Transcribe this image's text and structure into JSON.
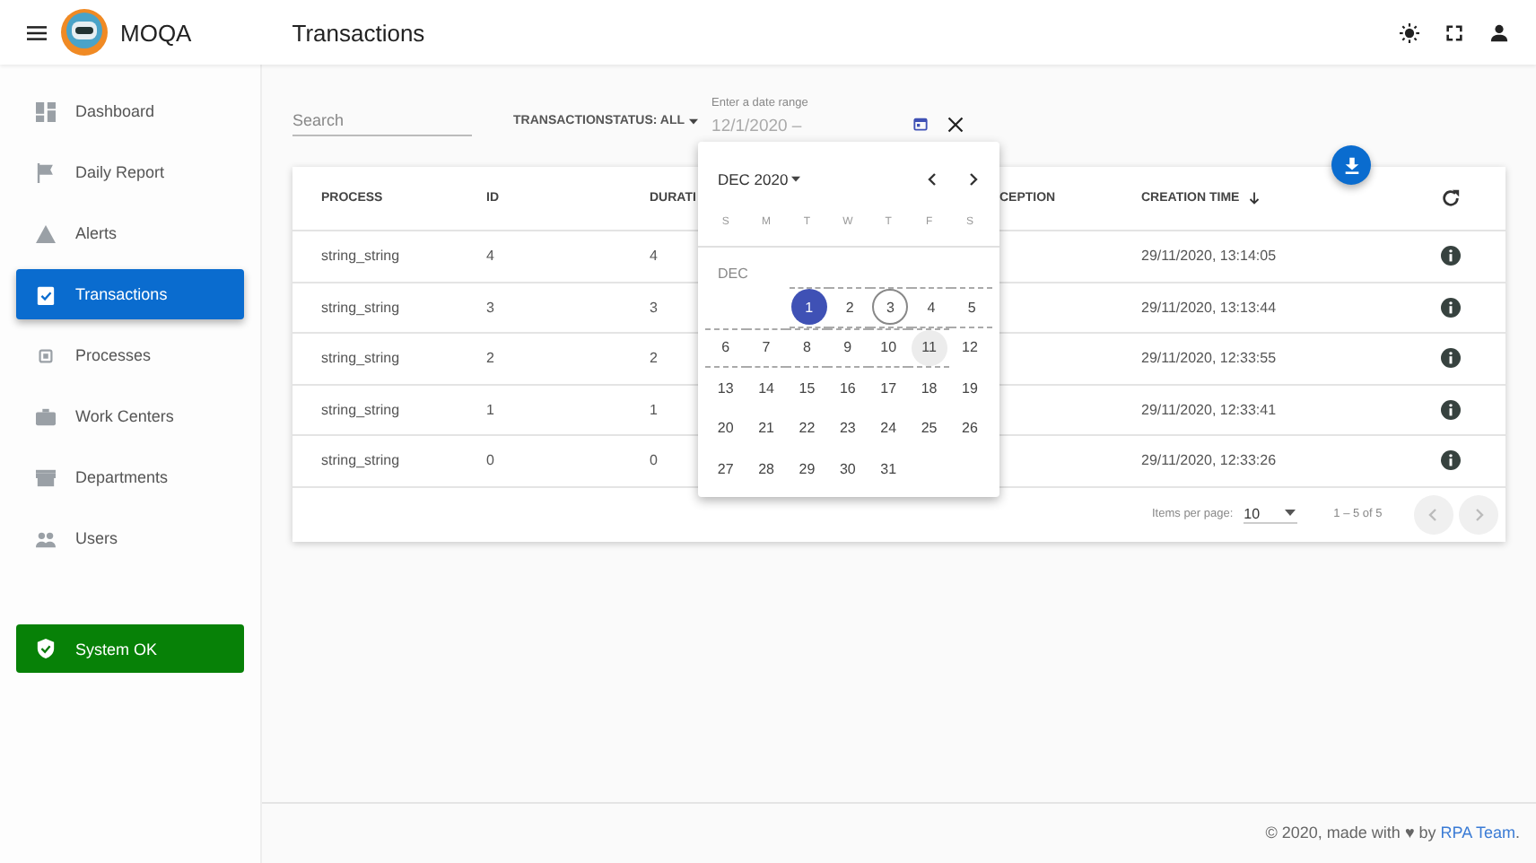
{
  "app": {
    "name": "MOQA",
    "page_title": "Transactions"
  },
  "sidebar": {
    "items": [
      {
        "label": "Dashboard",
        "selected": false
      },
      {
        "label": "Daily Report",
        "selected": false
      },
      {
        "label": "Alerts",
        "selected": false
      },
      {
        "label": "Transactions",
        "selected": true
      },
      {
        "label": "Processes",
        "selected": false
      },
      {
        "label": "Work Centers",
        "selected": false
      },
      {
        "label": "Departments",
        "selected": false
      },
      {
        "label": "Users",
        "selected": false
      }
    ],
    "status": {
      "label": "System OK",
      "ok": true
    }
  },
  "filters": {
    "search_placeholder": "Search",
    "status_filter": "TRANSACTIONSTATUS: ALL",
    "date_label": "Enter a date range",
    "date_value": "12/1/2020 –"
  },
  "table": {
    "columns": [
      "PROCESS",
      "ID",
      "DURATI",
      "CEPTION",
      "CREATION TIME"
    ],
    "rows": [
      {
        "process": "string_string",
        "id": "4",
        "duration": "4",
        "created": "29/11/2020, 13:14:05"
      },
      {
        "process": "string_string",
        "id": "3",
        "duration": "3",
        "created": "29/11/2020, 13:13:44"
      },
      {
        "process": "string_string",
        "id": "2",
        "duration": "2",
        "created": "29/11/2020, 12:33:55"
      },
      {
        "process": "string_string",
        "id": "1",
        "duration": "1",
        "created": "29/11/2020, 12:33:41"
      },
      {
        "process": "string_string",
        "id": "0",
        "duration": "0",
        "created": "29/11/2020, 12:33:26"
      }
    ],
    "paginator": {
      "items_label": "Items per page:",
      "page_size": "10",
      "range": "1 – 5 of 5"
    }
  },
  "calendar": {
    "period": "DEC 2020",
    "weekdays": [
      "S",
      "M",
      "T",
      "W",
      "T",
      "F",
      "S"
    ],
    "month_label": "DEC",
    "weeks": [
      [
        {
          "day": "1",
          "selected": true,
          "today": false,
          "preview": true,
          "hovered": false
        },
        {
          "day": "2",
          "selected": false,
          "today": false,
          "preview": true,
          "hovered": false
        },
        {
          "day": "3",
          "selected": false,
          "today": true,
          "preview": true,
          "hovered": false
        },
        {
          "day": "4",
          "selected": false,
          "today": false,
          "preview": true,
          "hovered": false
        },
        {
          "day": "5",
          "selected": false,
          "today": false,
          "preview": true,
          "hovered": false
        }
      ],
      [
        {
          "day": "6",
          "selected": false,
          "today": false,
          "preview": true,
          "hovered": false
        },
        {
          "day": "7",
          "selected": false,
          "today": false,
          "preview": true,
          "hovered": false
        },
        {
          "day": "8",
          "selected": false,
          "today": false,
          "preview": true,
          "hovered": false
        },
        {
          "day": "9",
          "selected": false,
          "today": false,
          "preview": true,
          "hovered": false
        },
        {
          "day": "10",
          "selected": false,
          "today": false,
          "preview": true,
          "hovered": false
        },
        {
          "day": "11",
          "selected": false,
          "today": false,
          "preview": true,
          "hovered": true
        },
        {
          "day": "12",
          "selected": false,
          "today": false,
          "preview": false,
          "hovered": false
        }
      ],
      [
        {
          "day": "13",
          "selected": false,
          "today": false,
          "preview": false,
          "hovered": false
        },
        {
          "day": "14",
          "selected": false,
          "today": false,
          "preview": false,
          "hovered": false
        },
        {
          "day": "15",
          "selected": false,
          "today": false,
          "preview": false,
          "hovered": false
        },
        {
          "day": "16",
          "selected": false,
          "today": false,
          "preview": false,
          "hovered": false
        },
        {
          "day": "17",
          "selected": false,
          "today": false,
          "preview": false,
          "hovered": false
        },
        {
          "day": "18",
          "selected": false,
          "today": false,
          "preview": false,
          "hovered": false
        },
        {
          "day": "19",
          "selected": false,
          "today": false,
          "preview": false,
          "hovered": false
        }
      ],
      [
        {
          "day": "20",
          "selected": false,
          "today": false,
          "preview": false,
          "hovered": false
        },
        {
          "day": "21",
          "selected": false,
          "today": false,
          "preview": false,
          "hovered": false
        },
        {
          "day": "22",
          "selected": false,
          "today": false,
          "preview": false,
          "hovered": false
        },
        {
          "day": "23",
          "selected": false,
          "today": false,
          "preview": false,
          "hovered": false
        },
        {
          "day": "24",
          "selected": false,
          "today": false,
          "preview": false,
          "hovered": false
        },
        {
          "day": "25",
          "selected": false,
          "today": false,
          "preview": false,
          "hovered": false
        },
        {
          "day": "26",
          "selected": false,
          "today": false,
          "preview": false,
          "hovered": false
        }
      ],
      [
        {
          "day": "27",
          "selected": false,
          "today": false,
          "preview": false,
          "hovered": false
        },
        {
          "day": "28",
          "selected": false,
          "today": false,
          "preview": false,
          "hovered": false
        },
        {
          "day": "29",
          "selected": false,
          "today": false,
          "preview": false,
          "hovered": false
        },
        {
          "day": "30",
          "selected": false,
          "today": false,
          "preview": false,
          "hovered": false
        },
        {
          "day": "31",
          "selected": false,
          "today": false,
          "preview": false,
          "hovered": false
        }
      ]
    ]
  },
  "footer": {
    "text": "© 2020, made with ♥ by",
    "link": "RPA Team",
    "end": "."
  }
}
